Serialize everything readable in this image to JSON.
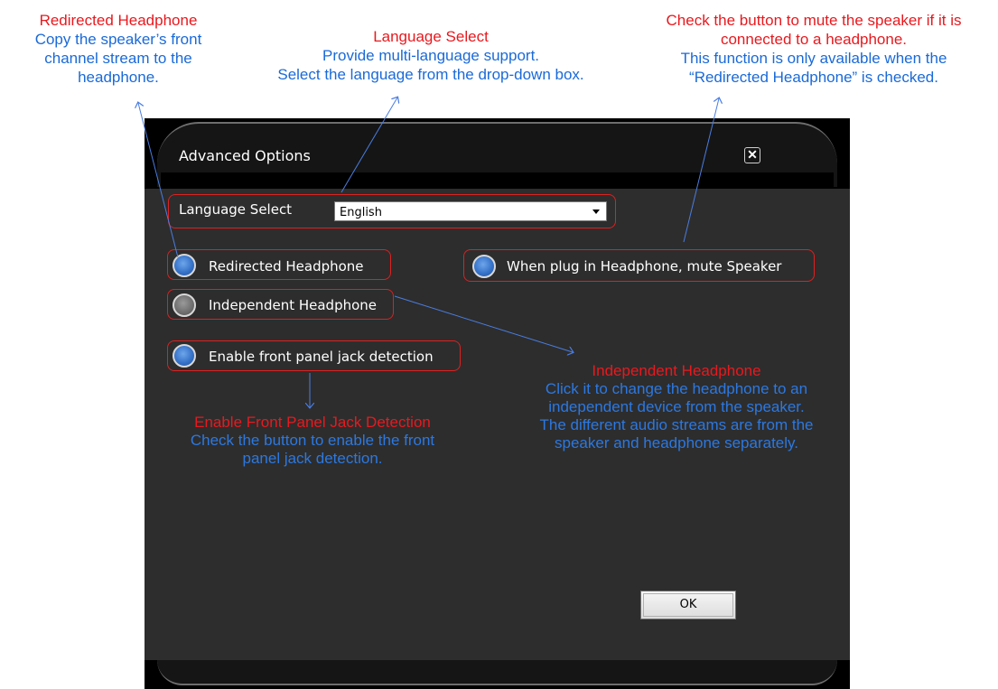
{
  "annotations": {
    "redirected": {
      "title": "Redirected Headphone",
      "lines": [
        "Copy the speaker’s front",
        "channel stream to the",
        "headphone."
      ]
    },
    "language": {
      "title": "Language Select",
      "lines": [
        "Provide multi-language support.",
        "Select the language from the drop-down box."
      ]
    },
    "mute": {
      "lines_red": [
        "Check the button to mute the speaker if it is",
        "connected to a headphone."
      ],
      "lines": [
        "This function is only available when the",
        "“Redirected Headphone” is checked."
      ]
    },
    "independent": {
      "title": "Independent Headphone",
      "lines": [
        "Click it to change the headphone to an",
        "independent device from the speaker.",
        "The different audio streams are from the",
        "speaker and headphone separately."
      ]
    },
    "jack": {
      "title": "Enable Front Panel Jack Detection",
      "lines": [
        "Check the button to enable the front",
        "panel jack detection."
      ]
    }
  },
  "dialog": {
    "title": "Advanced Options",
    "close_icon": "close-icon",
    "language_label": "Language Select",
    "language_value": "English",
    "options": {
      "redirected": {
        "label": "Redirected Headphone",
        "state": "on"
      },
      "independent": {
        "label": "Independent Headphone",
        "state": "off"
      },
      "jack": {
        "label": "Enable front panel jack detection",
        "state": "on"
      },
      "mute": {
        "label": "When plug in Headphone, mute Speaker",
        "state": "on"
      }
    },
    "ok_label": "OK"
  },
  "colors": {
    "annotation_title": "#e8191e",
    "annotation_text": "#1a6ad8",
    "highlight": "#e02020",
    "dialog_bg": "#2d2d2d",
    "radio_on": "#3673c9"
  }
}
